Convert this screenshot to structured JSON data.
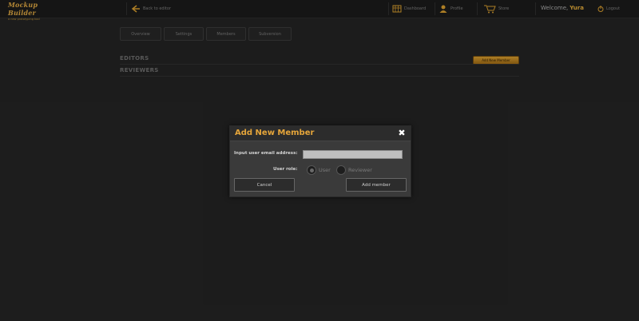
{
  "app": {
    "logo_title": "Mockup Builder",
    "logo_sub": "a new prototyping tool"
  },
  "topbar": {
    "back_label": "Back to editor",
    "dashboard_label": "Dashboard",
    "profile_label": "Profile",
    "store_label": "Store",
    "welcome_text": "Welcome,",
    "username": "Yura",
    "logout_label": "Logout"
  },
  "tabs": [
    {
      "label": "Overview"
    },
    {
      "label": "Settings"
    },
    {
      "label": "Members"
    },
    {
      "label": "Subversion"
    }
  ],
  "sections": {
    "editors_title": "EDITORS",
    "reviewers_title": "REVIEWERS",
    "add_new_member_button": "Add New Member"
  },
  "modal": {
    "title": "Add New Member",
    "email_label": "Input user email address:",
    "email_value": "",
    "role_label": "User role:",
    "roles": [
      {
        "label": "User",
        "checked": true
      },
      {
        "label": "Reviewer",
        "checked": false
      }
    ],
    "cancel_label": "Cancel",
    "submit_label": "Add member"
  },
  "colors": {
    "accent": "#e5a53a",
    "background": "#232323",
    "modal_bg": "#3a3a3a"
  }
}
